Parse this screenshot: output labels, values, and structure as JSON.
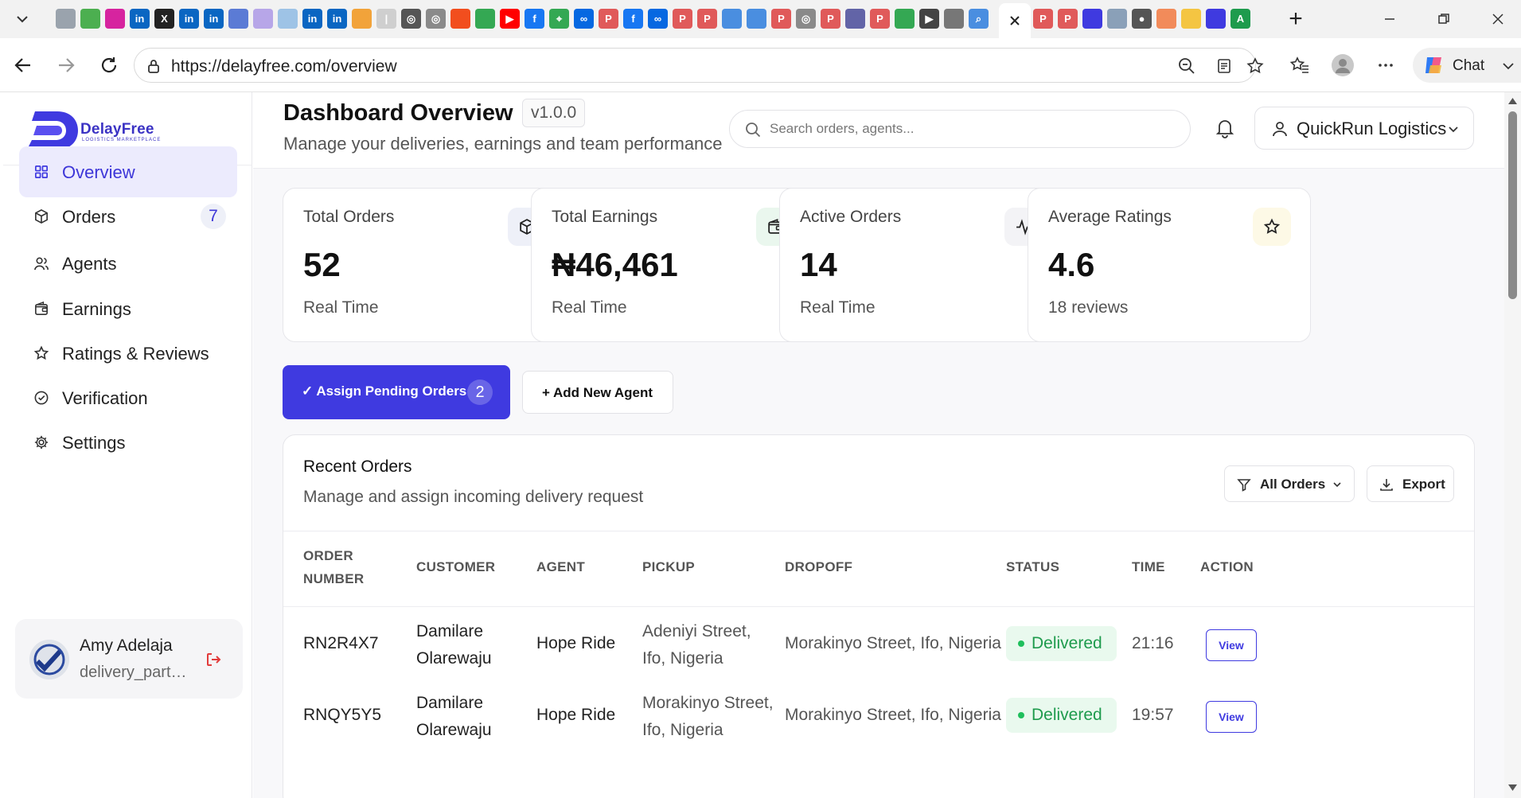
{
  "browser": {
    "url": "https://delayfree.com/overview",
    "chat_label": "Chat",
    "tab_icons": [
      {
        "name": "page-icon",
        "color": "#9aa3ad"
      },
      {
        "name": "maps-app-icon",
        "color": "#4caf50"
      },
      {
        "name": "instagram-icon",
        "color": "#d6249f"
      },
      {
        "name": "linkedin-icon",
        "color": "#0a66c2"
      },
      {
        "name": "x-icon",
        "color": "#222222"
      },
      {
        "name": "linkedin-icon",
        "color": "#0a66c2"
      },
      {
        "name": "linkedin-icon",
        "color": "#0a66c2"
      },
      {
        "name": "forms-icon",
        "color": "#5b7bd5"
      },
      {
        "name": "image-icon",
        "color": "#b7a6e8"
      },
      {
        "name": "tool-icon",
        "color": "#9ec3e6"
      },
      {
        "name": "linkedin-icon",
        "color": "#0a66c2"
      },
      {
        "name": "linkedin-icon",
        "color": "#0a66c2"
      },
      {
        "name": "grid-app-icon",
        "color": "#f2a33a"
      },
      {
        "name": "divider-icon",
        "color": "#cfcfcf"
      },
      {
        "name": "globe-icon",
        "color": "#555555"
      },
      {
        "name": "globe-icon",
        "color": "#8a8a8a"
      },
      {
        "name": "figma-icon",
        "color": "#f24e1e"
      },
      {
        "name": "sheets-icon",
        "color": "#34a853"
      },
      {
        "name": "youtube-icon",
        "color": "#ff0000"
      },
      {
        "name": "facebook-icon",
        "color": "#1877f2"
      },
      {
        "name": "maps-icon",
        "color": "#34a853"
      },
      {
        "name": "meta-icon",
        "color": "#0668e1"
      },
      {
        "name": "pdf-icon",
        "color": "#e05a5a"
      },
      {
        "name": "facebook-icon",
        "color": "#1877f2"
      },
      {
        "name": "meta-icon",
        "color": "#0668e1"
      },
      {
        "name": "pdf-icon",
        "color": "#e05a5a"
      },
      {
        "name": "pdf-icon",
        "color": "#e05a5a"
      },
      {
        "name": "list-icon",
        "color": "#4a8ee0"
      },
      {
        "name": "list-icon",
        "color": "#4a8ee0"
      },
      {
        "name": "pdf-icon",
        "color": "#e05a5a"
      },
      {
        "name": "globe-icon",
        "color": "#8a8a8a"
      },
      {
        "name": "pdf-icon",
        "color": "#e05a5a"
      },
      {
        "name": "teams-icon",
        "color": "#6264a7"
      },
      {
        "name": "pdf-icon",
        "color": "#e05a5a"
      },
      {
        "name": "sheets-icon",
        "color": "#34a853"
      },
      {
        "name": "play-icon",
        "color": "#444444"
      },
      {
        "name": "settings-page-icon",
        "color": "#777777"
      },
      {
        "name": "search-tab-icon",
        "color": "#4a8ee0"
      }
    ],
    "tab_icons_right": [
      {
        "name": "pdf-icon",
        "color": "#e05a5a"
      },
      {
        "name": "pdf-icon",
        "color": "#e05a5a"
      },
      {
        "name": "delayfree-tab-icon",
        "color": "#3f3ae0"
      },
      {
        "name": "bird-icon",
        "color": "#8aa0b8"
      },
      {
        "name": "circle-app-icon",
        "color": "#555555"
      },
      {
        "name": "wave-app-icon",
        "color": "#f28b5a"
      },
      {
        "name": "yellow-app-icon",
        "color": "#f4c542"
      },
      {
        "name": "delayfree-tab-icon",
        "color": "#3f3ae0"
      },
      {
        "name": "a-app-icon",
        "color": "#1e9b4d"
      }
    ]
  },
  "brand": {
    "name": "DelayFree",
    "tagline": "LOGISTICS MARKETPLACE",
    "accent": "#3f3ae0"
  },
  "sidebar": {
    "items": [
      {
        "label": "Overview",
        "icon": "grid-icon",
        "active": true
      },
      {
        "label": "Orders",
        "icon": "package-icon",
        "badge": "7"
      },
      {
        "label": "Agents",
        "icon": "users-icon"
      },
      {
        "label": "Earnings",
        "icon": "wallet-icon"
      },
      {
        "label": "Ratings & Reviews",
        "icon": "star-icon"
      },
      {
        "label": "Verification",
        "icon": "check-circle-icon"
      },
      {
        "label": "Settings",
        "icon": "gear-icon"
      }
    ],
    "user": {
      "name": "Amy Adelaja",
      "role": "delivery_partner"
    }
  },
  "header": {
    "title": "Dashboard Overview",
    "version": "v1.0.0",
    "subtitle": "Manage your deliveries, earnings and team performance",
    "search_placeholder": "Search orders, agents...",
    "company": "QuickRun Logistics"
  },
  "stats": [
    {
      "label": "Total Orders",
      "value": "52",
      "footer": "Real Time",
      "icon": "package-icon",
      "icon_bg": "#eef0f8"
    },
    {
      "label": "Total Earnings",
      "value": "₦46,461",
      "footer": "Real Time",
      "icon": "wallet-icon",
      "icon_bg": "#eaf7ee"
    },
    {
      "label": "Active Orders",
      "value": "14",
      "footer": "Real Time",
      "icon": "activity-icon",
      "icon_bg": "#f3f3f6"
    },
    {
      "label": "Average Ratings",
      "value": "4.6",
      "footer": "18 reviews",
      "icon": "star-icon",
      "icon_bg": "#fdf9e6"
    }
  ],
  "actions": {
    "assign_label": "✓ Assign Pending Orders",
    "assign_count": "2",
    "add_agent_label": "+ Add New Agent"
  },
  "orders": {
    "title": "Recent Orders",
    "subtitle": "Manage and assign incoming delivery request",
    "filter_label": "All Orders",
    "export_label": "Export",
    "columns": [
      "ORDER NUMBER",
      "CUSTOMER",
      "AGENT",
      "PICKUP",
      "DROPOFF",
      "STATUS",
      "TIME",
      "ACTION"
    ],
    "rows": [
      {
        "order": "RN2R4X7",
        "customer": "Damilare Olarewaju",
        "agent": "Hope Ride",
        "pickup": "Adeniyi Street, Ifo, Nigeria",
        "dropoff": "Morakinyo Street, Ifo, Nigeria",
        "status": "Delivered",
        "time": "21:16",
        "action": "View"
      },
      {
        "order": "RNQY5Y5",
        "customer": "Damilare Olarewaju",
        "agent": "Hope Ride",
        "pickup": "Morakinyo Street, Ifo, Nigeria",
        "dropoff": "Morakinyo Street, Ifo, Nigeria",
        "status": "Delivered",
        "time": "19:57",
        "action": "View"
      }
    ]
  }
}
